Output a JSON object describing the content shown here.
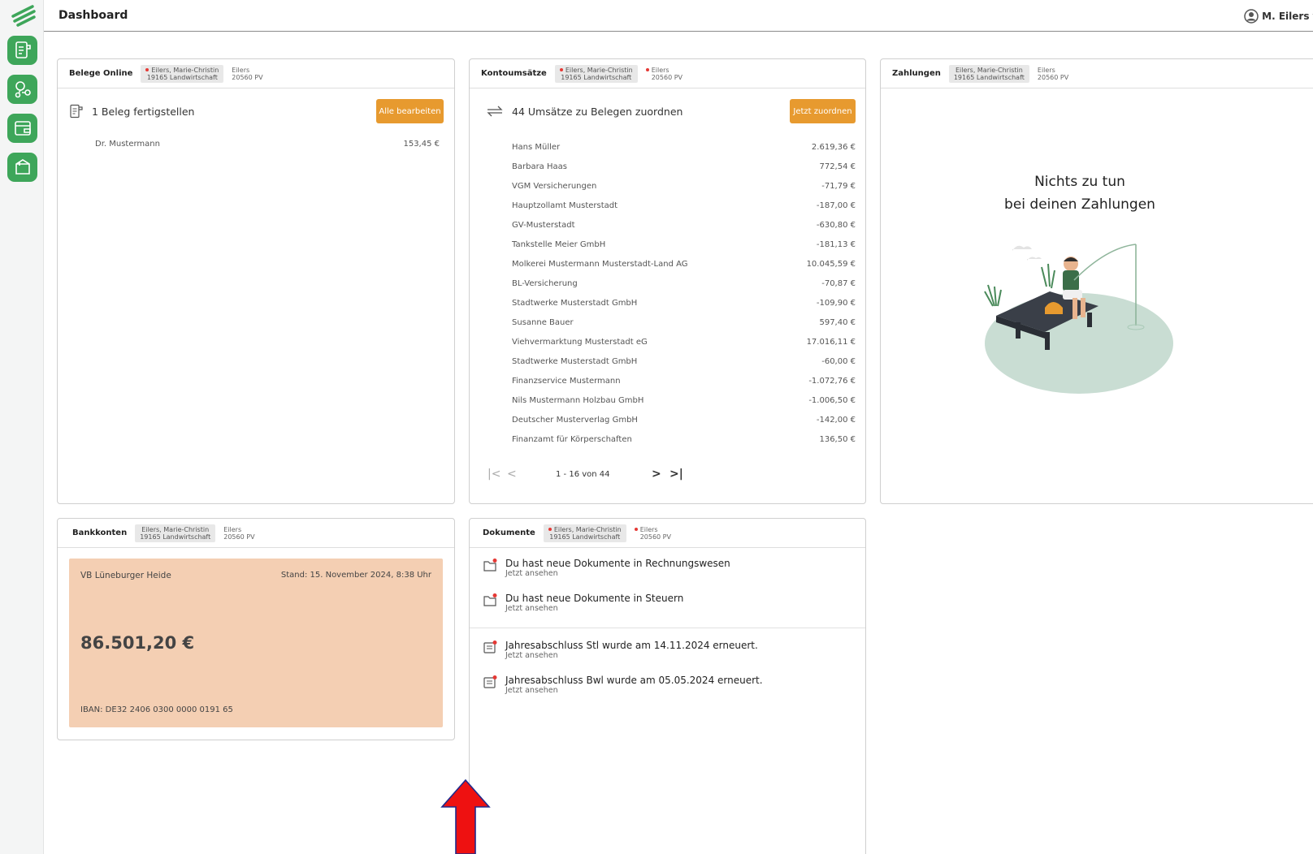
{
  "header": {
    "title": "Dashboard",
    "user_name": "M. Eilers"
  },
  "sidebar": {
    "items": [
      {
        "icon": "document-icon"
      },
      {
        "icon": "coins-icon"
      },
      {
        "icon": "wallet-icon"
      },
      {
        "icon": "box-icon"
      }
    ]
  },
  "client": {
    "name": "Eilers, Marie-Christin",
    "sub": "19165 Landwirtschaft",
    "alt_name": "Eilers",
    "alt_sub": "20560 PV"
  },
  "belege": {
    "title": "Belege Online",
    "task": "1 Beleg fertigstellen",
    "button": "Alle bearbeiten",
    "item_name": "Dr. Mustermann",
    "item_amount": "153,45 €"
  },
  "kontoumsaetze": {
    "title": "Kontoumsätze",
    "task": "44 Umsätze zu Belegen zuordnen",
    "button": "Jetzt zuordnen",
    "transactions": [
      {
        "name": "Hans Müller",
        "amount": "2.619,36 €"
      },
      {
        "name": "Barbara Haas",
        "amount": "772,54 €"
      },
      {
        "name": "VGM Versicherungen",
        "amount": "-71,79 €"
      },
      {
        "name": "Hauptzollamt Musterstadt",
        "amount": "-187,00 €"
      },
      {
        "name": "GV-Musterstadt",
        "amount": "-630,80 €"
      },
      {
        "name": "Tankstelle Meier GmbH",
        "amount": "-181,13 €"
      },
      {
        "name": "Molkerei Mustermann Musterstadt-Land AG",
        "amount": "10.045,59 €"
      },
      {
        "name": "BL-Versicherung",
        "amount": "-70,87 €"
      },
      {
        "name": "Stadtwerke Musterstadt GmbH",
        "amount": "-109,90 €"
      },
      {
        "name": "Susanne Bauer",
        "amount": "597,40 €"
      },
      {
        "name": "Viehvermarktung Musterstadt eG",
        "amount": "17.016,11 €"
      },
      {
        "name": "Stadtwerke Musterstadt GmbH",
        "amount": "-60,00 €"
      },
      {
        "name": "Finanzservice Mustermann",
        "amount": "-1.072,76 €"
      },
      {
        "name": "Nils Mustermann Holzbau GmbH",
        "amount": "-1.006,50 €"
      },
      {
        "name": "Deutscher Musterverlag GmbH",
        "amount": "-142,00 €"
      },
      {
        "name": "Finanzamt für Körperschaften",
        "amount": "136,50 €"
      }
    ],
    "pager_text": "1 - 16 von 44"
  },
  "zahlungen": {
    "title": "Zahlungen",
    "empty_line1": "Nichts zu tun",
    "empty_line2": "bei deinen Zahlungen"
  },
  "bankkonten": {
    "title": "Bankkonten",
    "bank_name": "VB Lüneburger Heide",
    "stand": "Stand: 15. November 2024, 8:38 Uhr",
    "balance": "86.501,20 €",
    "iban": "IBAN: DE32 2406 0300 0000 0191 65"
  },
  "dokumente": {
    "title": "Dokumente",
    "items": [
      {
        "text": "Du hast neue Dokumente in Rechnungswesen",
        "link": "Jetzt ansehen"
      },
      {
        "text": "Du hast neue Dokumente in Steuern",
        "link": "Jetzt ansehen"
      },
      {
        "text": "Jahresabschluss Stl wurde am 14.11.2024 erneuert.",
        "link": "Jetzt ansehen"
      },
      {
        "text": "Jahresabschluss Bwl wurde am 05.05.2024 erneuert.",
        "link": "Jetzt ansehen"
      }
    ]
  },
  "colors": {
    "brand_green": "#3ea65a",
    "accent_orange": "#e79a2f",
    "card_peach": "#f4cfb3",
    "alert_red": "#e53935"
  }
}
